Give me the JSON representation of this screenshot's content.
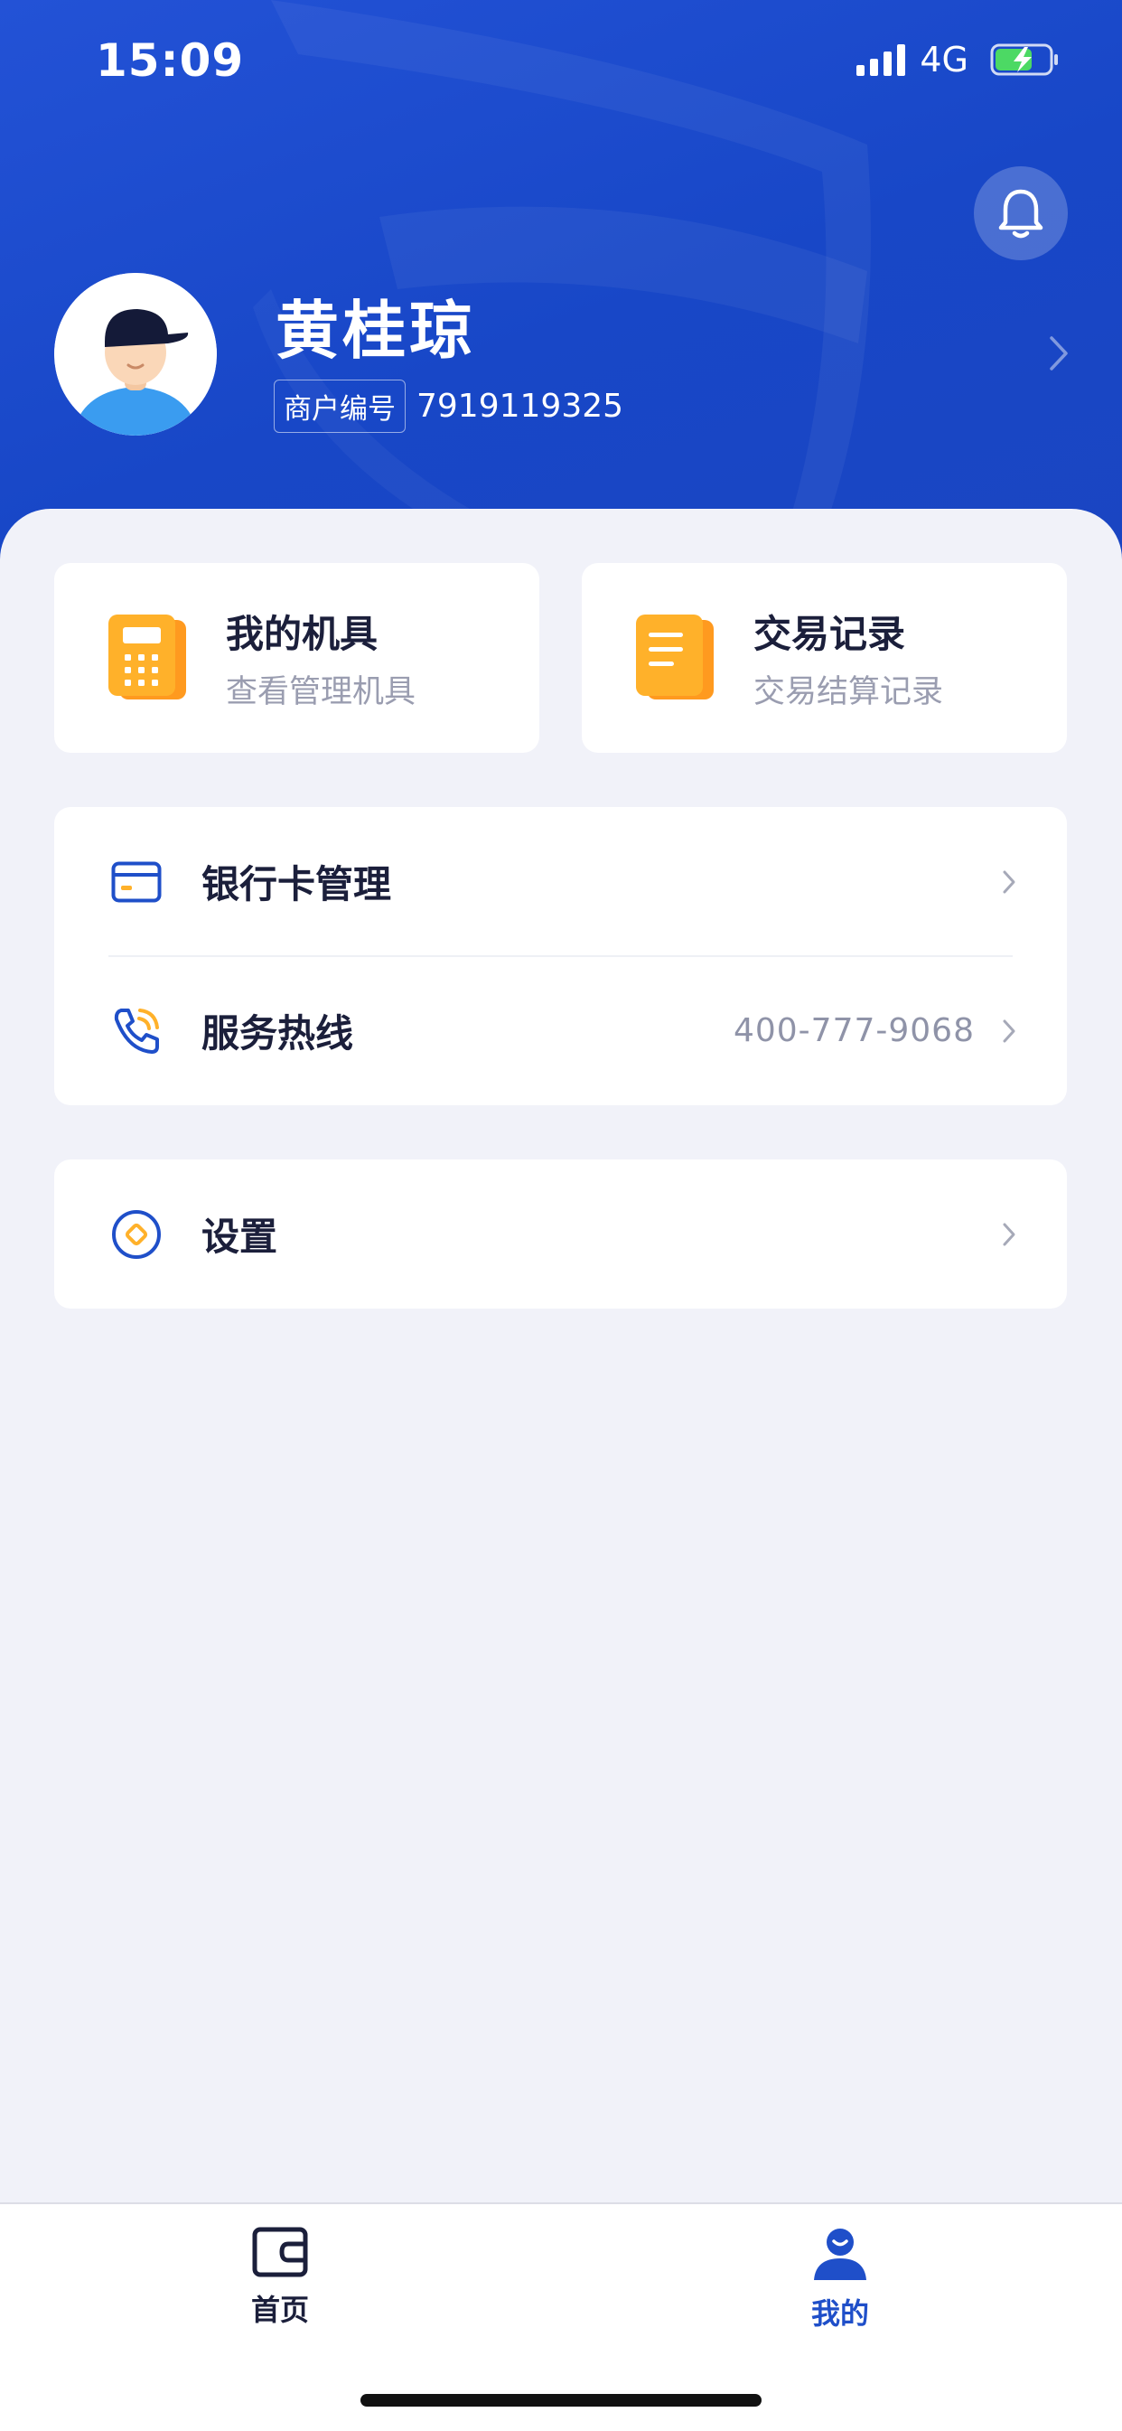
{
  "status_bar": {
    "time": "15:09",
    "network": "4G",
    "battery": "charging"
  },
  "profile": {
    "name": "黄桂琼",
    "merchant_label": "商户编号",
    "merchant_id": "7919119325"
  },
  "quick_cards": [
    {
      "title": "我的机具",
      "subtitle": "查看管理机具",
      "icon": "pos-terminal-icon"
    },
    {
      "title": "交易记录",
      "subtitle": "交易结算记录",
      "icon": "document-icon"
    }
  ],
  "menu": {
    "bank_card": "银行卡管理",
    "hotline": "服务热线",
    "hotline_number": "400-777-9068",
    "settings": "设置"
  },
  "tabs": [
    {
      "label": "首页",
      "icon": "wallet-icon",
      "active": false
    },
    {
      "label": "我的",
      "icon": "person-icon",
      "active": true
    }
  ],
  "colors": {
    "brand_blue": "#1847c7",
    "accent_orange": "#ffb12a",
    "text_dark": "#1b1f3b",
    "text_muted": "#9a9db0",
    "page_bg": "#f1f2f9"
  }
}
